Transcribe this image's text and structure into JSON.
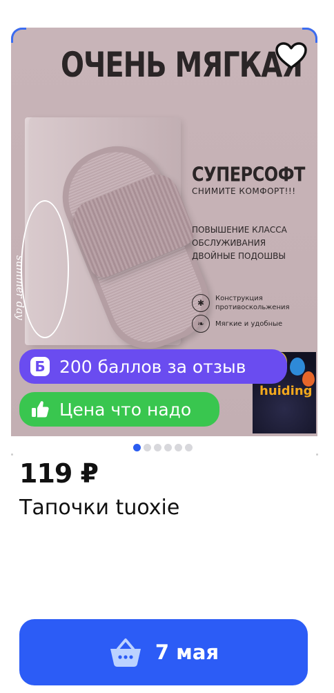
{
  "promo": {
    "title": "ОЧЕНЬ МЯГКАЯ",
    "brand_on_box": "summer day",
    "headline": "СУПЕРСОФТ",
    "subheadline": "СНИМИТЕ КОМФОРТ!!!",
    "features_block": [
      "ПОВЫШЕНИЕ КЛАССА",
      "ОБСЛУЖИВАНИЯ",
      "ДВОЙНЫЕ ПОДОШВЫ"
    ],
    "feature_1": [
      "Конструкция",
      "противоскольжения"
    ],
    "feature_2": "Мягкие и удобные",
    "thumbnail_text": "huiding"
  },
  "badges": {
    "points_icon": "Б",
    "points_text": "200 баллов за отзыв",
    "price_text": "Цена что надо"
  },
  "gallery": {
    "dots_total": 6,
    "active_index": 0
  },
  "product": {
    "price": "119 ₽",
    "name": "Тапочки tuoxie"
  },
  "delivery": {
    "label": "7 мая"
  },
  "colors": {
    "accent_blue": "#2c5cf6",
    "points_purple": "#6a4cf0",
    "price_green": "#39c64f"
  },
  "icons": [
    "heart-icon",
    "thumbs-up-icon",
    "basket-icon"
  ]
}
